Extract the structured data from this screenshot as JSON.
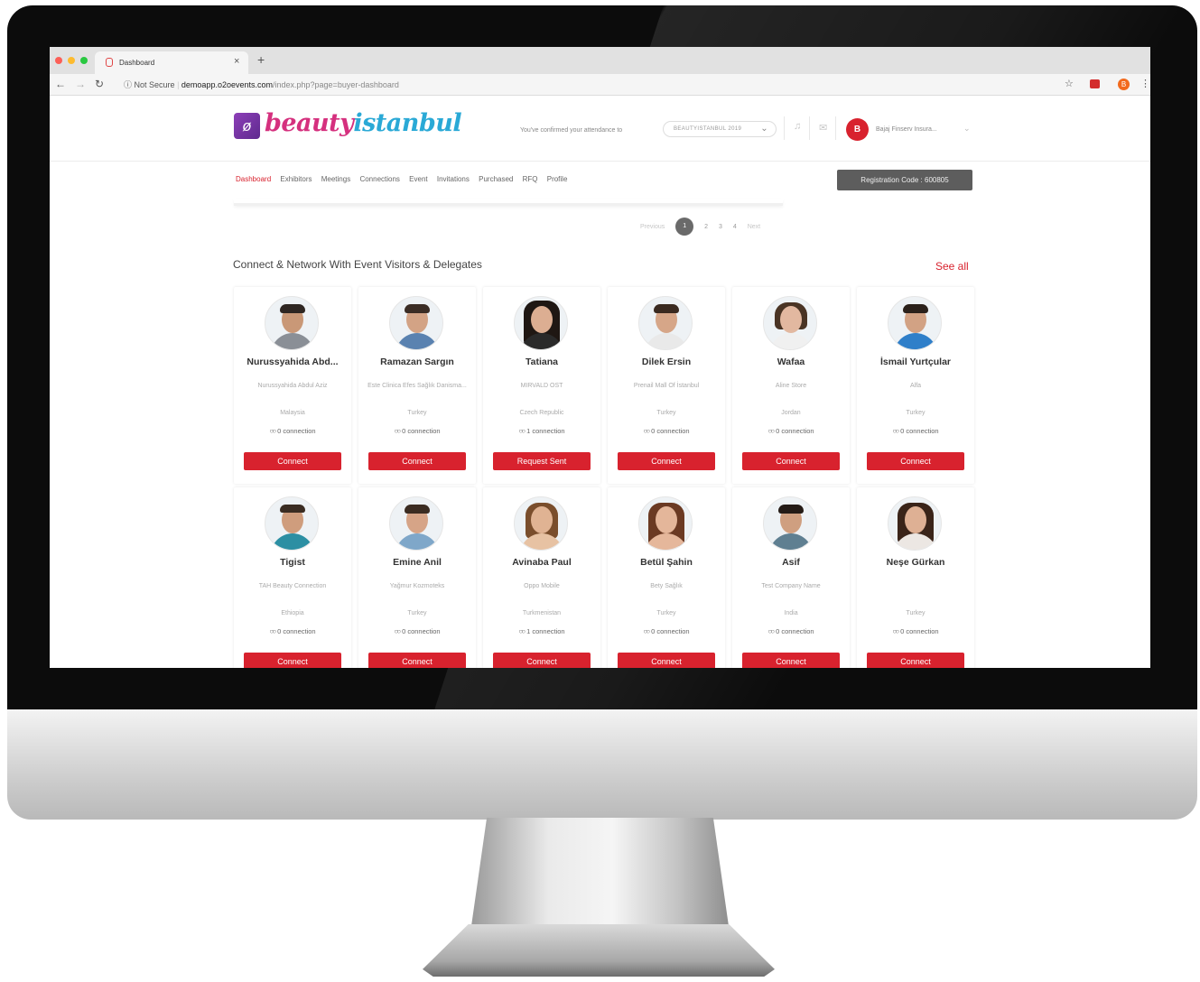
{
  "browser": {
    "tab_title": "Dashboard",
    "tab_close": "×",
    "new_tab": "+",
    "security": "Not Secure",
    "url_host": "demoapp.o2oevents.com",
    "url_path": "/index.php?page=buyer-dashboard",
    "extension_badge": "B"
  },
  "header": {
    "logo_part1": "beauty",
    "logo_part2": "istanbul",
    "attendance_text": "You've confirmed your attendance to",
    "event_selected": "BEAUTYISTANBUL 2019",
    "user_initial": "B",
    "user_name": "Bajaj Finserv Insura..."
  },
  "menu": {
    "items": [
      "Dashboard",
      "Exhibitors",
      "Meetings",
      "Connections",
      "Event",
      "Invitations",
      "Purchased",
      "RFQ",
      "Profile"
    ],
    "active_index": 0
  },
  "registration_code": "Registration Code : 600805",
  "pagination": {
    "previous": "Previous",
    "pages": [
      "1",
      "2",
      "3",
      "4"
    ],
    "active": "1",
    "next": "Next"
  },
  "section": {
    "title": "Connect & Network With Event Visitors & Delegates",
    "see_all": "See all"
  },
  "colors": {
    "accent": "#d8222e",
    "logo_pink": "#d5307e",
    "logo_blue": "#2aa9d6",
    "logo_purple": "#8d3fb8"
  },
  "people": [
    {
      "name": "Nurussyahida Abd...",
      "company": "Nurussyahida Abdul Aziz",
      "country": "Malaysia",
      "connections": "0 connection",
      "action": "Connect"
    },
    {
      "name": "Ramazan Sargın",
      "company": "Este Clinica Efes Sağlık Danisma...",
      "country": "Turkey",
      "connections": "0 connection",
      "action": "Connect"
    },
    {
      "name": "Tatiana",
      "company": "MIRVALD OST",
      "country": "Czech Republic",
      "connections": "1 connection",
      "action": "Request Sent"
    },
    {
      "name": "Dilek Ersin",
      "company": "Prenail Mall Of İstanbul",
      "country": "Turkey",
      "connections": "0 connection",
      "action": "Connect"
    },
    {
      "name": "Wafaa",
      "company": "Aline Store",
      "country": "Jordan",
      "connections": "0 connection",
      "action": "Connect"
    },
    {
      "name": "İsmail Yurtçular",
      "company": "Alfa",
      "country": "Turkey",
      "connections": "0 connection",
      "action": "Connect"
    },
    {
      "name": "Tigist",
      "company": "TAH Beauty Connection",
      "country": "Ethiopia",
      "connections": "0 connection",
      "action": "Connect"
    },
    {
      "name": "Emine Anil",
      "company": "Yağmur Kozmoteks",
      "country": "Turkey",
      "connections": "0 connection",
      "action": "Connect"
    },
    {
      "name": "Avinaba Paul",
      "company": "Oppo Mobile",
      "country": "Turkmenistan",
      "connections": "1 connection",
      "action": "Connect"
    },
    {
      "name": "Betül Şahin",
      "company": "Bety Sağlık",
      "country": "Turkey",
      "connections": "0 connection",
      "action": "Connect"
    },
    {
      "name": "Asif",
      "company": "Test Company Name",
      "country": "India",
      "connections": "0 connection",
      "action": "Connect"
    },
    {
      "name": "Neşe Gürkan",
      "company": "",
      "country": "Turkey",
      "connections": "0 connection",
      "action": "Connect"
    }
  ]
}
